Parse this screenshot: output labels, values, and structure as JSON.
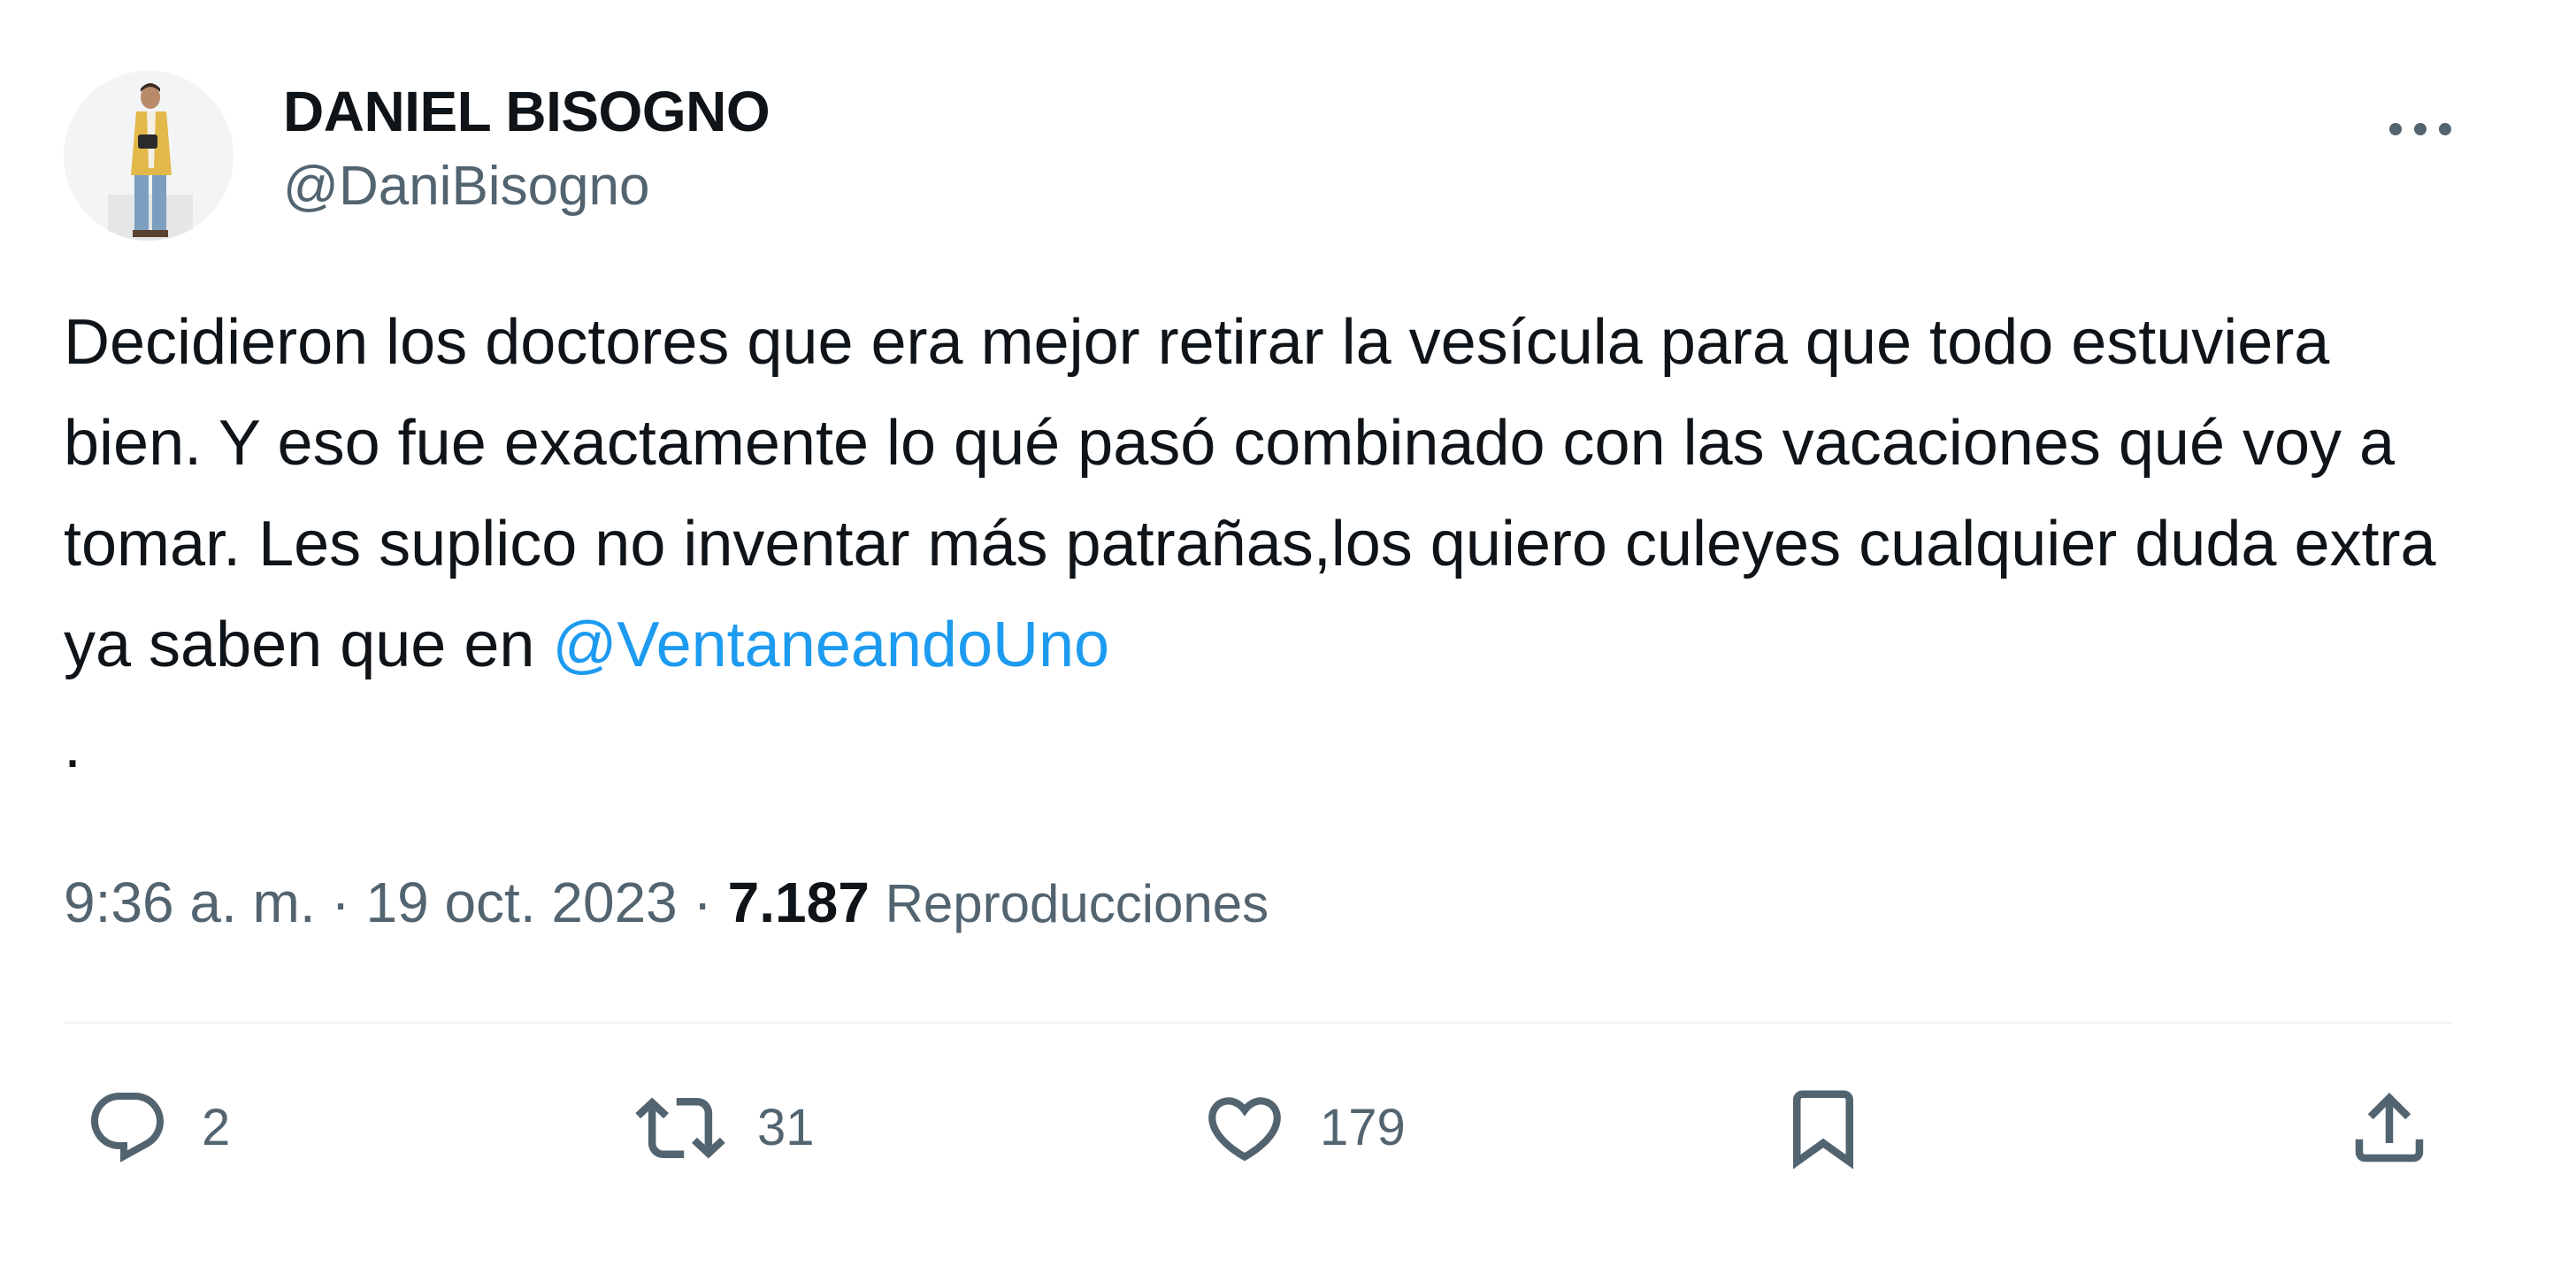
{
  "author": {
    "display_name": "DANIEL BISOGNO",
    "handle": "@DaniBisogno"
  },
  "tweet": {
    "text_before_mention": "Decidieron los doctores que era mejor retirar la vesícula para que todo estuviera bien. Y eso fue exactamente lo qué pasó combinado con las vacaciones qué voy a tomar. Les suplico no inventar más patrañas,los quiero culeyes cualquier duda extra ya saben que en ",
    "mention": "@VentaneandoUno",
    "text_after_mention": "."
  },
  "meta": {
    "time": "9:36 a. m.",
    "separator1": " · ",
    "date": "19 oct. 2023",
    "separator2": " · ",
    "views_count": "7.187",
    "views_label": "Reproducciones"
  },
  "actions": {
    "reply": {
      "icon": "reply-icon",
      "count": "2"
    },
    "retweet": {
      "icon": "retweet-icon",
      "count": "31"
    },
    "like": {
      "icon": "heart-icon",
      "count": "179"
    },
    "bookmark": {
      "icon": "bookmark-icon"
    },
    "share": {
      "icon": "share-icon"
    }
  },
  "colors": {
    "text": "#0f1419",
    "secondary": "#536471",
    "mention": "#1d9bf0",
    "divider": "#eff3f4"
  }
}
